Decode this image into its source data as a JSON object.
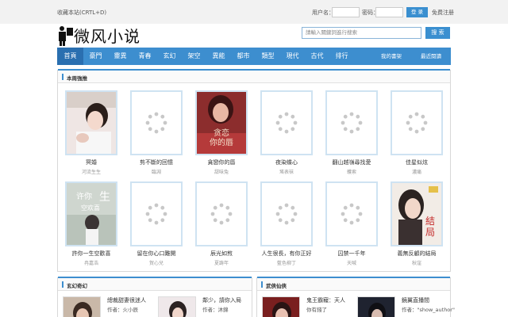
{
  "topbar": {
    "favorite": "收藏本站(CRTL+D)",
    "username_label": "用户名：",
    "password_label": "密码：",
    "login_button": "登 录",
    "register_link": "免费注册"
  },
  "logo": {
    "text": "微风小说"
  },
  "search": {
    "placeholder": "請輸入關鍵詞進行搜索",
    "button": "搜 索"
  },
  "nav": {
    "items": [
      "首頁",
      "豪門",
      "靈異",
      "青春",
      "玄幻",
      "架空",
      "異能",
      "都市",
      "類型",
      "現代",
      "古代",
      "排行"
    ],
    "bookshelf": "我的書架",
    "recent": "最近閱讀"
  },
  "recommend": {
    "title": "本周強推",
    "books": [
      {
        "title": "冥婚",
        "author": "河流生生"
      },
      {
        "title": "剪不斷的回憶",
        "author": "臨淵"
      },
      {
        "title": "貪戀你的唇",
        "author": "甜味兔"
      },
      {
        "title": "夜染蝶心",
        "author": "瑤表袜"
      },
      {
        "title": "翻山越嶺尋找愛",
        "author": "蠖索"
      },
      {
        "title": "佳星似炫",
        "author": "濃痛"
      },
      {
        "title": "許你一生空歡喜",
        "author": "冉嘉浩"
      },
      {
        "title": "留在你心口難開",
        "author": "賀心兒"
      },
      {
        "title": "辰光如煎",
        "author": "夏踌年"
      },
      {
        "title": "人生很長，有你正好",
        "author": "藍色柳丁"
      },
      {
        "title": "囚禁一千年",
        "author": "天喊"
      },
      {
        "title": "義無反顧的結局",
        "author": "秋窪"
      }
    ]
  },
  "sections": {
    "xuanhuan": {
      "title": "玄幻奇幻",
      "items": [
        {
          "title": "總裁甜妻很迷人",
          "author": "作者：火小辰"
        },
        {
          "title": "鄰少，請你入局",
          "author": "作者：沐錦"
        }
      ]
    },
    "wuxia": {
      "title": "武俠仙俠",
      "items": [
        {
          "title": "鬼王霸寵：天人",
          "author": "你有錢了"
        },
        {
          "title": "鏡翼直播間",
          "author": "作者：\"show_author\""
        }
      ]
    }
  },
  "colors": {
    "accent": "#3d8ecf",
    "nav_active": "#2a6fb0"
  }
}
